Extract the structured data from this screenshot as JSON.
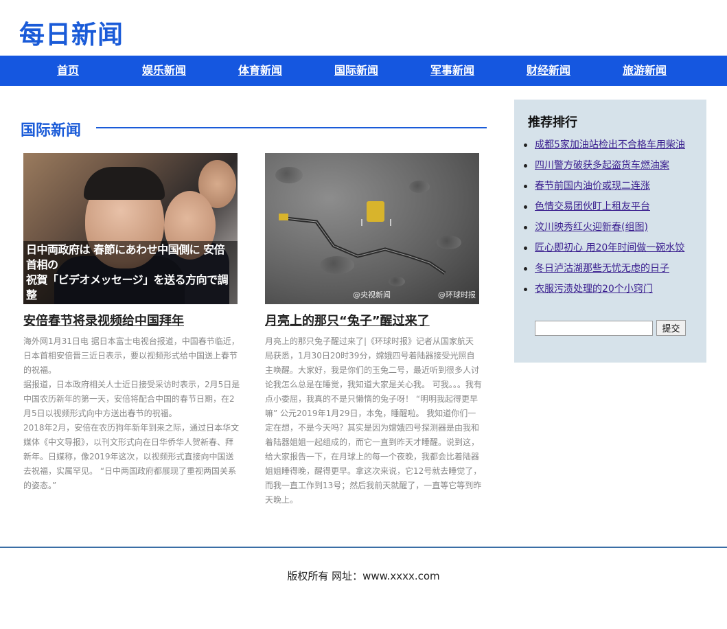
{
  "site": {
    "title": "每日新闻"
  },
  "nav": {
    "items": [
      "首页",
      "娱乐新闻",
      "体育新闻",
      "国际新闻",
      "军事新闻",
      "财经新闻",
      "旅游新闻"
    ]
  },
  "section": {
    "title": "国际新闻"
  },
  "articles": [
    {
      "image_caption_line1": "日中両政府は 春節にあわせ中国側に 安倍首相の",
      "image_caption_line2": "祝賀「ビデオメッセージ」を送る方向で調整",
      "headline": "安倍春节将录视频给中国拜年",
      "paragraphs": [
        "海外网1月31日电 据日本富士电视台报道，中国春节临近，日本首相安倍晋三近日表示，要以视频形式给中国送上春节的祝福。",
        "据报道，日本政府相关人士近日接受采访时表示，2月5日是中国农历新年的第一天，安倍将配合中国的春节日期，在2月5日以视频形式向中方送出春节的祝福。",
        "2018年2月，安倍在农历狗年新年到来之际，通过日本华文媒体《中文导报》，以刊文形式向在日华侨华人贺新春、拜新年。日媒称，像2019年这次，以视频形式直接向中国送去祝福，实属罕见。 “日中两国政府都展现了重视两国关系的姿态。”"
      ]
    },
    {
      "image_watermark_1": "@央视新闻",
      "image_watermark_2": "@环球时报",
      "headline": "月亮上的那只“兔子”醒过来了",
      "paragraphs": [
        "月亮上的那只兔子醒过来了|《环球时报》记者从国家航天局获悉，1月30日20时39分，嫦娥四号着陆器接受光照自主唤醒。大家好，我是你们的玉兔二号，最近听到很多人讨论我怎么总是在睡觉，我知道大家是关心我。 可我。。。我有点小委屈，我真的不是只懒惰的兔子呀！ “明明我起得更早嘛” 公元2019年1月29日，本兔，睡醒啦。 我知道你们一定在想，不是今天吗？其实是因为嫦娥四号探测器是由我和着陆器姐姐一起组成的，而它一直到昨天才睡醒。说到这，给大家报告一下，在月球上的每一个夜晚，我都会比着陆器姐姐睡得晚，醒得更早。拿这次来说，它12号就去睡觉了，而我一直工作到13号；然后我前天就醒了，一直等它等到昨天晚上。"
      ]
    }
  ],
  "sidebar": {
    "title": "推荐排行",
    "items": [
      "成都5家加油站检出不合格车用柴油",
      "四川警方破获多起盗货车燃油案",
      "春节前国内油价或现二连涨",
      "色情交易团伙盯上租友平台",
      "汶川映秀红火迎新春(组图)",
      "匠心即初心 用20年时间做一碗水饺",
      "冬日泸沽湖那些无忧无虑的日子",
      "衣服污渍处理的20个小窍门"
    ],
    "search_value": "",
    "submit_label": "提交"
  },
  "footer": {
    "text": "版权所有 网址：www.xxxx.com"
  },
  "colors": {
    "brand": "#1a5bd8",
    "nav_bg": "#1557e0",
    "sidebar_bg": "#d6e2ea",
    "link": "#3a1f8f"
  }
}
